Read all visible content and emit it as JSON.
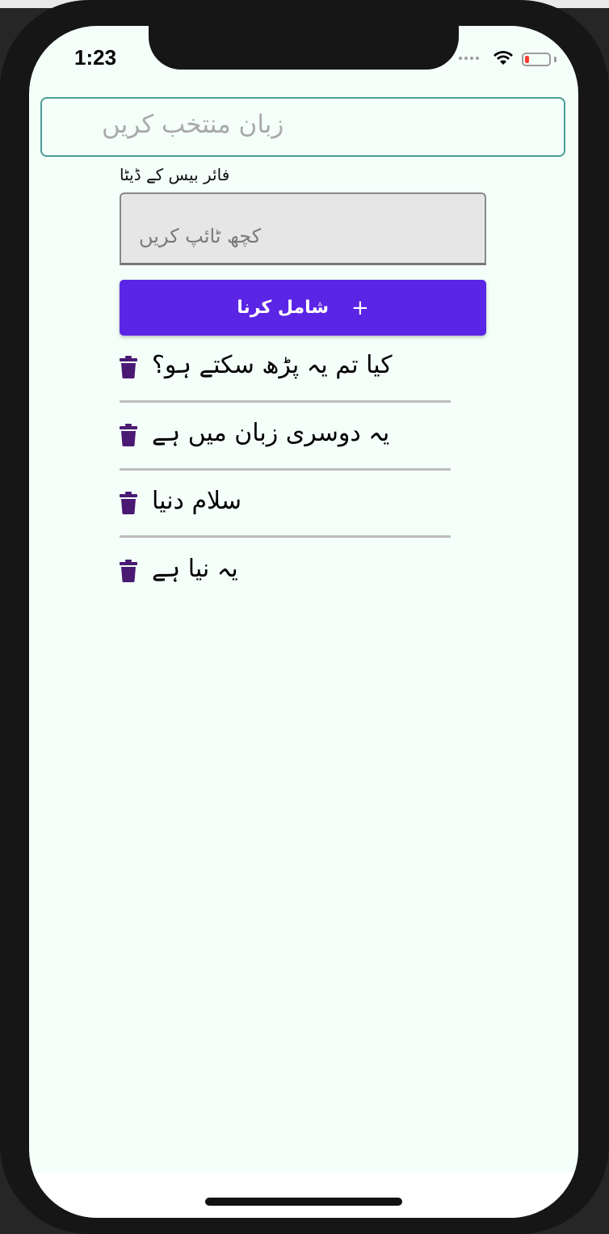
{
  "status_bar": {
    "time": "1:23"
  },
  "language_select": {
    "placeholder": "زبان منتخب کریں"
  },
  "firebase_section": {
    "label": "فائر بیس کے ڈیٹا",
    "input_placeholder": "کچھ ٹائپ کریں"
  },
  "add_button": {
    "plus": "+",
    "label": "شامل کرنا"
  },
  "items": [
    {
      "text": "کیا تم یہ پڑھ سکتے ہو؟"
    },
    {
      "text": "یہ دوسری زبان میں ہے"
    },
    {
      "text": "سلام دنیا"
    },
    {
      "text": "یہ نیا ہے"
    }
  ],
  "colors": {
    "accent": "#5b25e6",
    "trash_icon": "#4a1a73",
    "select_border": "#4a9e96",
    "background": "#f4fff9"
  },
  "icons": {
    "delete": "trash-icon",
    "wifi": "wifi-icon",
    "battery": "battery-icon"
  }
}
